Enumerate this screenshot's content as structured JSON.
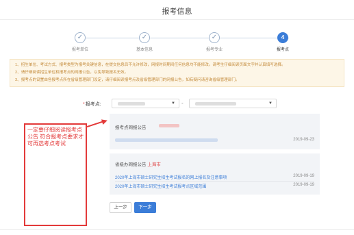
{
  "header": {
    "title": "报考信息"
  },
  "stepper": {
    "steps": [
      {
        "label": "报考单位",
        "icon": "check-icon",
        "glyph": "✓",
        "state": "done"
      },
      {
        "label": "基本信息",
        "icon": "check-icon",
        "glyph": "✓",
        "state": "done"
      },
      {
        "label": "报考专业",
        "icon": "check-icon",
        "glyph": "✓",
        "state": "done"
      },
      {
        "label": "报考点",
        "icon": "",
        "glyph": "4",
        "state": "active"
      }
    ]
  },
  "notice": {
    "lines": [
      "1、招生单位、考试方式、报考类型为报考关键信息，在提交信息后不允许修改，网报时间期间任何信息均不能修改。请考生仔细阅读页面文字并认真填写选择。",
      "2、请仔细阅读招生单位和报考点的网报公告，以免导致报名无效。",
      "3、报考点的设置由各报考点所在省级管理部门设定，请仔细阅读报考点及省级管理部门的网报公告，如有疑问请咨询省级管理部门。"
    ]
  },
  "form": {
    "label": "报考点:",
    "required_mark": "*",
    "dash": "-"
  },
  "panels": {
    "site_notice": {
      "title": "报考点网报公告",
      "date": "2019-09-23"
    },
    "province_notice": {
      "title_prefix": "省级办网报公告",
      "title_city": "上海市",
      "items": [
        {
          "text": "2020年上海市硕士研究生招生考试报名的网上报名及注意事项",
          "date": "2019-09-19"
        },
        {
          "text": "2020年上海市硕士研究生招生考试报考点区域范围",
          "date": "2019-09-19"
        }
      ]
    }
  },
  "annotation": {
    "text": "一定要仔细阅读报考点公告 符合报考点要求才可再选考点考试"
  },
  "buttons": {
    "prev": "上一步",
    "next": "下一步"
  },
  "colors": {
    "primary": "#3b7dd8",
    "annotation": "#e33a3a",
    "notice_text": "#c38a3a"
  }
}
